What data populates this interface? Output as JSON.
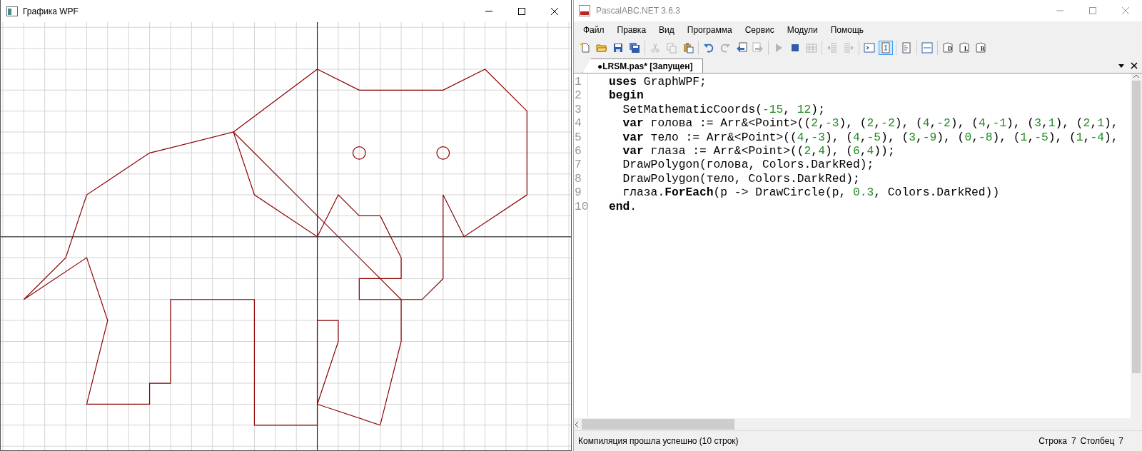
{
  "graphics_window": {
    "title": "Графика WPF"
  },
  "ide_window": {
    "title": "PascalABC.NET 3.6.3",
    "menu": [
      "Файл",
      "Правка",
      "Вид",
      "Программа",
      "Сервис",
      "Модули",
      "Помощь"
    ],
    "toolbar": [
      {
        "items": [
          {
            "kind": "new",
            "disabled": false,
            "pressed": false
          },
          {
            "kind": "open",
            "disabled": false,
            "pressed": false
          },
          {
            "kind": "save",
            "disabled": false,
            "pressed": false
          },
          {
            "kind": "save-all",
            "disabled": false,
            "pressed": false
          }
        ]
      },
      {
        "items": [
          {
            "kind": "cut",
            "disabled": true,
            "pressed": false
          },
          {
            "kind": "copy",
            "disabled": true,
            "pressed": false
          },
          {
            "kind": "paste",
            "disabled": false,
            "pressed": false
          }
        ]
      },
      {
        "items": [
          {
            "kind": "undo",
            "disabled": false,
            "pressed": false
          },
          {
            "kind": "redo",
            "disabled": true,
            "pressed": false
          },
          {
            "kind": "doc-back",
            "disabled": false,
            "pressed": false
          },
          {
            "kind": "doc-forward",
            "disabled": true,
            "pressed": false
          }
        ]
      },
      {
        "items": [
          {
            "kind": "run",
            "disabled": true,
            "pressed": false
          },
          {
            "kind": "stop",
            "disabled": false,
            "pressed": false
          },
          {
            "kind": "grid",
            "disabled": true,
            "pressed": false
          }
        ]
      },
      {
        "items": [
          {
            "kind": "indent-left",
            "disabled": true,
            "pressed": false
          },
          {
            "kind": "indent-right",
            "disabled": true,
            "pressed": false
          }
        ]
      },
      {
        "items": [
          {
            "kind": "console",
            "disabled": false,
            "pressed": false
          },
          {
            "kind": "frame",
            "disabled": false,
            "pressed": true
          }
        ]
      },
      {
        "items": [
          {
            "kind": "page",
            "disabled": false,
            "pressed": false
          }
        ]
      },
      {
        "items": [
          {
            "kind": "code",
            "disabled": false,
            "pressed": false
          }
        ]
      },
      {
        "items": [
          {
            "kind": "doc-letter",
            "glyph": "D",
            "disabled": false,
            "pressed": false
          },
          {
            "kind": "doc-letter",
            "glyph": "L",
            "disabled": false,
            "pressed": false
          },
          {
            "kind": "doc-letter",
            "glyph": "R",
            "disabled": false,
            "pressed": false
          }
        ]
      }
    ],
    "tabs": [
      {
        "label": "●LRSM.pas* [Запущен]",
        "selected": true
      }
    ],
    "editor": {
      "lines": [
        {
          "number": "1",
          "indented": false,
          "tokens": [
            {
              "kind": "keyword",
              "text": "uses"
            },
            {
              "kind": "plain",
              "text": " GraphWPF;"
            }
          ]
        },
        {
          "number": "2",
          "indented": false,
          "tokens": [
            {
              "kind": "keyword",
              "text": "begin"
            }
          ]
        },
        {
          "number": "3",
          "indented": true,
          "tokens": [
            {
              "kind": "plain",
              "text": "SetMathematicCoords("
            },
            {
              "kind": "number",
              "text": "-15"
            },
            {
              "kind": "plain",
              "text": ", "
            },
            {
              "kind": "number",
              "text": "12"
            },
            {
              "kind": "plain",
              "text": ");"
            }
          ]
        },
        {
          "number": "4",
          "indented": true,
          "tokens": [
            {
              "kind": "keyword",
              "text": "var"
            },
            {
              "kind": "plain",
              "text": " голова := Arr&<Point>(("
            },
            {
              "kind": "number",
              "text": "2"
            },
            {
              "kind": "plain",
              "text": ","
            },
            {
              "kind": "number",
              "text": "-3"
            },
            {
              "kind": "plain",
              "text": "), ("
            },
            {
              "kind": "number",
              "text": "2"
            },
            {
              "kind": "plain",
              "text": ","
            },
            {
              "kind": "number",
              "text": "-2"
            },
            {
              "kind": "plain",
              "text": "), ("
            },
            {
              "kind": "number",
              "text": "4"
            },
            {
              "kind": "plain",
              "text": ","
            },
            {
              "kind": "number",
              "text": "-2"
            },
            {
              "kind": "plain",
              "text": "), ("
            },
            {
              "kind": "number",
              "text": "4"
            },
            {
              "kind": "plain",
              "text": ","
            },
            {
              "kind": "number",
              "text": "-1"
            },
            {
              "kind": "plain",
              "text": "), ("
            },
            {
              "kind": "number",
              "text": "3"
            },
            {
              "kind": "plain",
              "text": ","
            },
            {
              "kind": "number",
              "text": "1"
            },
            {
              "kind": "plain",
              "text": "), ("
            },
            {
              "kind": "number",
              "text": "2"
            },
            {
              "kind": "plain",
              "text": ","
            },
            {
              "kind": "number",
              "text": "1"
            },
            {
              "kind": "plain",
              "text": "),"
            }
          ]
        },
        {
          "number": "5",
          "indented": true,
          "tokens": [
            {
              "kind": "keyword",
              "text": "var"
            },
            {
              "kind": "plain",
              "text": " тело := Arr&<Point>(("
            },
            {
              "kind": "number",
              "text": "4"
            },
            {
              "kind": "plain",
              "text": ","
            },
            {
              "kind": "number",
              "text": "-3"
            },
            {
              "kind": "plain",
              "text": "), ("
            },
            {
              "kind": "number",
              "text": "4"
            },
            {
              "kind": "plain",
              "text": ","
            },
            {
              "kind": "number",
              "text": "-5"
            },
            {
              "kind": "plain",
              "text": "), ("
            },
            {
              "kind": "number",
              "text": "3"
            },
            {
              "kind": "plain",
              "text": ","
            },
            {
              "kind": "number",
              "text": "-9"
            },
            {
              "kind": "plain",
              "text": "), ("
            },
            {
              "kind": "number",
              "text": "0"
            },
            {
              "kind": "plain",
              "text": ","
            },
            {
              "kind": "number",
              "text": "-8"
            },
            {
              "kind": "plain",
              "text": "), ("
            },
            {
              "kind": "number",
              "text": "1"
            },
            {
              "kind": "plain",
              "text": ","
            },
            {
              "kind": "number",
              "text": "-5"
            },
            {
              "kind": "plain",
              "text": "), ("
            },
            {
              "kind": "number",
              "text": "1"
            },
            {
              "kind": "plain",
              "text": ","
            },
            {
              "kind": "number",
              "text": "-4"
            },
            {
              "kind": "plain",
              "text": "),"
            }
          ]
        },
        {
          "number": "6",
          "indented": true,
          "tokens": [
            {
              "kind": "keyword",
              "text": "var"
            },
            {
              "kind": "plain",
              "text": " глаза := Arr&<Point>(("
            },
            {
              "kind": "number",
              "text": "2"
            },
            {
              "kind": "plain",
              "text": ","
            },
            {
              "kind": "number",
              "text": "4"
            },
            {
              "kind": "plain",
              "text": "), ("
            },
            {
              "kind": "number",
              "text": "6"
            },
            {
              "kind": "plain",
              "text": ","
            },
            {
              "kind": "number",
              "text": "4"
            },
            {
              "kind": "plain",
              "text": "));"
            }
          ]
        },
        {
          "number": "7",
          "indented": true,
          "tokens": [
            {
              "kind": "plain",
              "text": "DrawPolygon(голова, Colors.DarkRed);"
            }
          ]
        },
        {
          "number": "8",
          "indented": true,
          "tokens": [
            {
              "kind": "plain",
              "text": "DrawPolygon(тело, Colors.DarkRed);"
            }
          ]
        },
        {
          "number": "9",
          "indented": true,
          "tokens": [
            {
              "kind": "plain",
              "text": "глаза."
            },
            {
              "kind": "keyword",
              "text": "ForEach"
            },
            {
              "kind": "plain",
              "text": "(p -> DrawCircle(p, "
            },
            {
              "kind": "number",
              "text": "0.3"
            },
            {
              "kind": "plain",
              "text": ", Colors.DarkRed))"
            }
          ]
        },
        {
          "number": "10",
          "indented": false,
          "tokens": [
            {
              "kind": "keyword",
              "text": "end"
            },
            {
              "kind": "plain",
              "text": "."
            }
          ]
        }
      ]
    },
    "status_bar": {
      "message": "Компиляция прошла успешно (10 строк)",
      "line_label": "Строка",
      "line": "7",
      "column_label": "Столбец",
      "column": "7"
    }
  }
}
